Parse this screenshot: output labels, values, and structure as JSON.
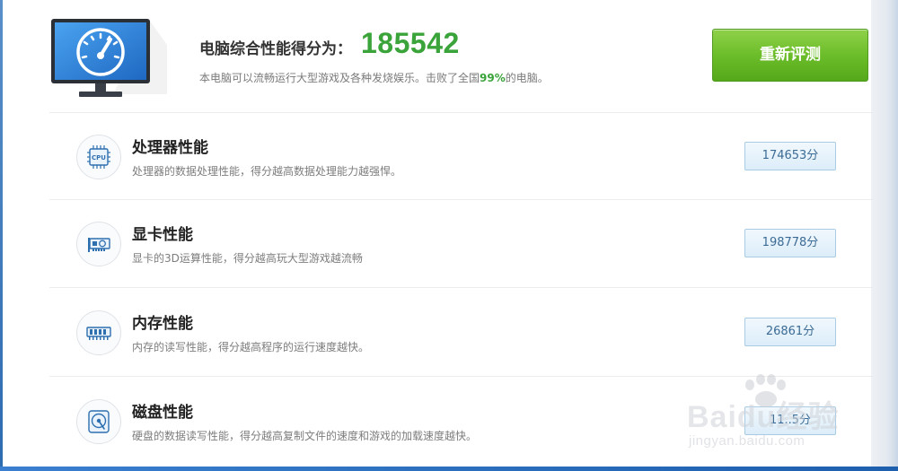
{
  "summary": {
    "title": "电脑综合性能得分为：",
    "score": "185542",
    "desc_prefix": "本电脑可以流畅运行大型游戏及各种发烧娱乐。击败了全国",
    "desc_percent": "99%",
    "desc_suffix": "的电脑。",
    "retest_label": "重新评测"
  },
  "items": [
    {
      "icon": "cpu-icon",
      "title": "处理器性能",
      "desc": "处理器的数据处理性能，得分越高数据处理能力越强悍。",
      "score": "174653分"
    },
    {
      "icon": "graphics-card-icon",
      "title": "显卡性能",
      "desc": "显卡的3D运算性能，得分越高玩大型游戏越流畅",
      "score": "198778分"
    },
    {
      "icon": "memory-icon",
      "title": "内存性能",
      "desc": "内存的读写性能，得分越高程序的运行速度越快。",
      "score": "26861分"
    },
    {
      "icon": "disk-icon",
      "title": "磁盘性能",
      "desc": "硬盘的数据读写性能，得分越高复制文件的速度和游戏的加载速度越快。",
      "score": "11..5分"
    }
  ],
  "cpu_chip_label": "CPU",
  "watermark": {
    "brand": "Baidu经验",
    "url": "jingyan.baidu.com"
  },
  "colors": {
    "accent_green": "#3aa33a",
    "button_green": "#6cbd2a",
    "score_badge_border": "#a9cbe4",
    "monitor_blue": "#2f7fd0"
  }
}
